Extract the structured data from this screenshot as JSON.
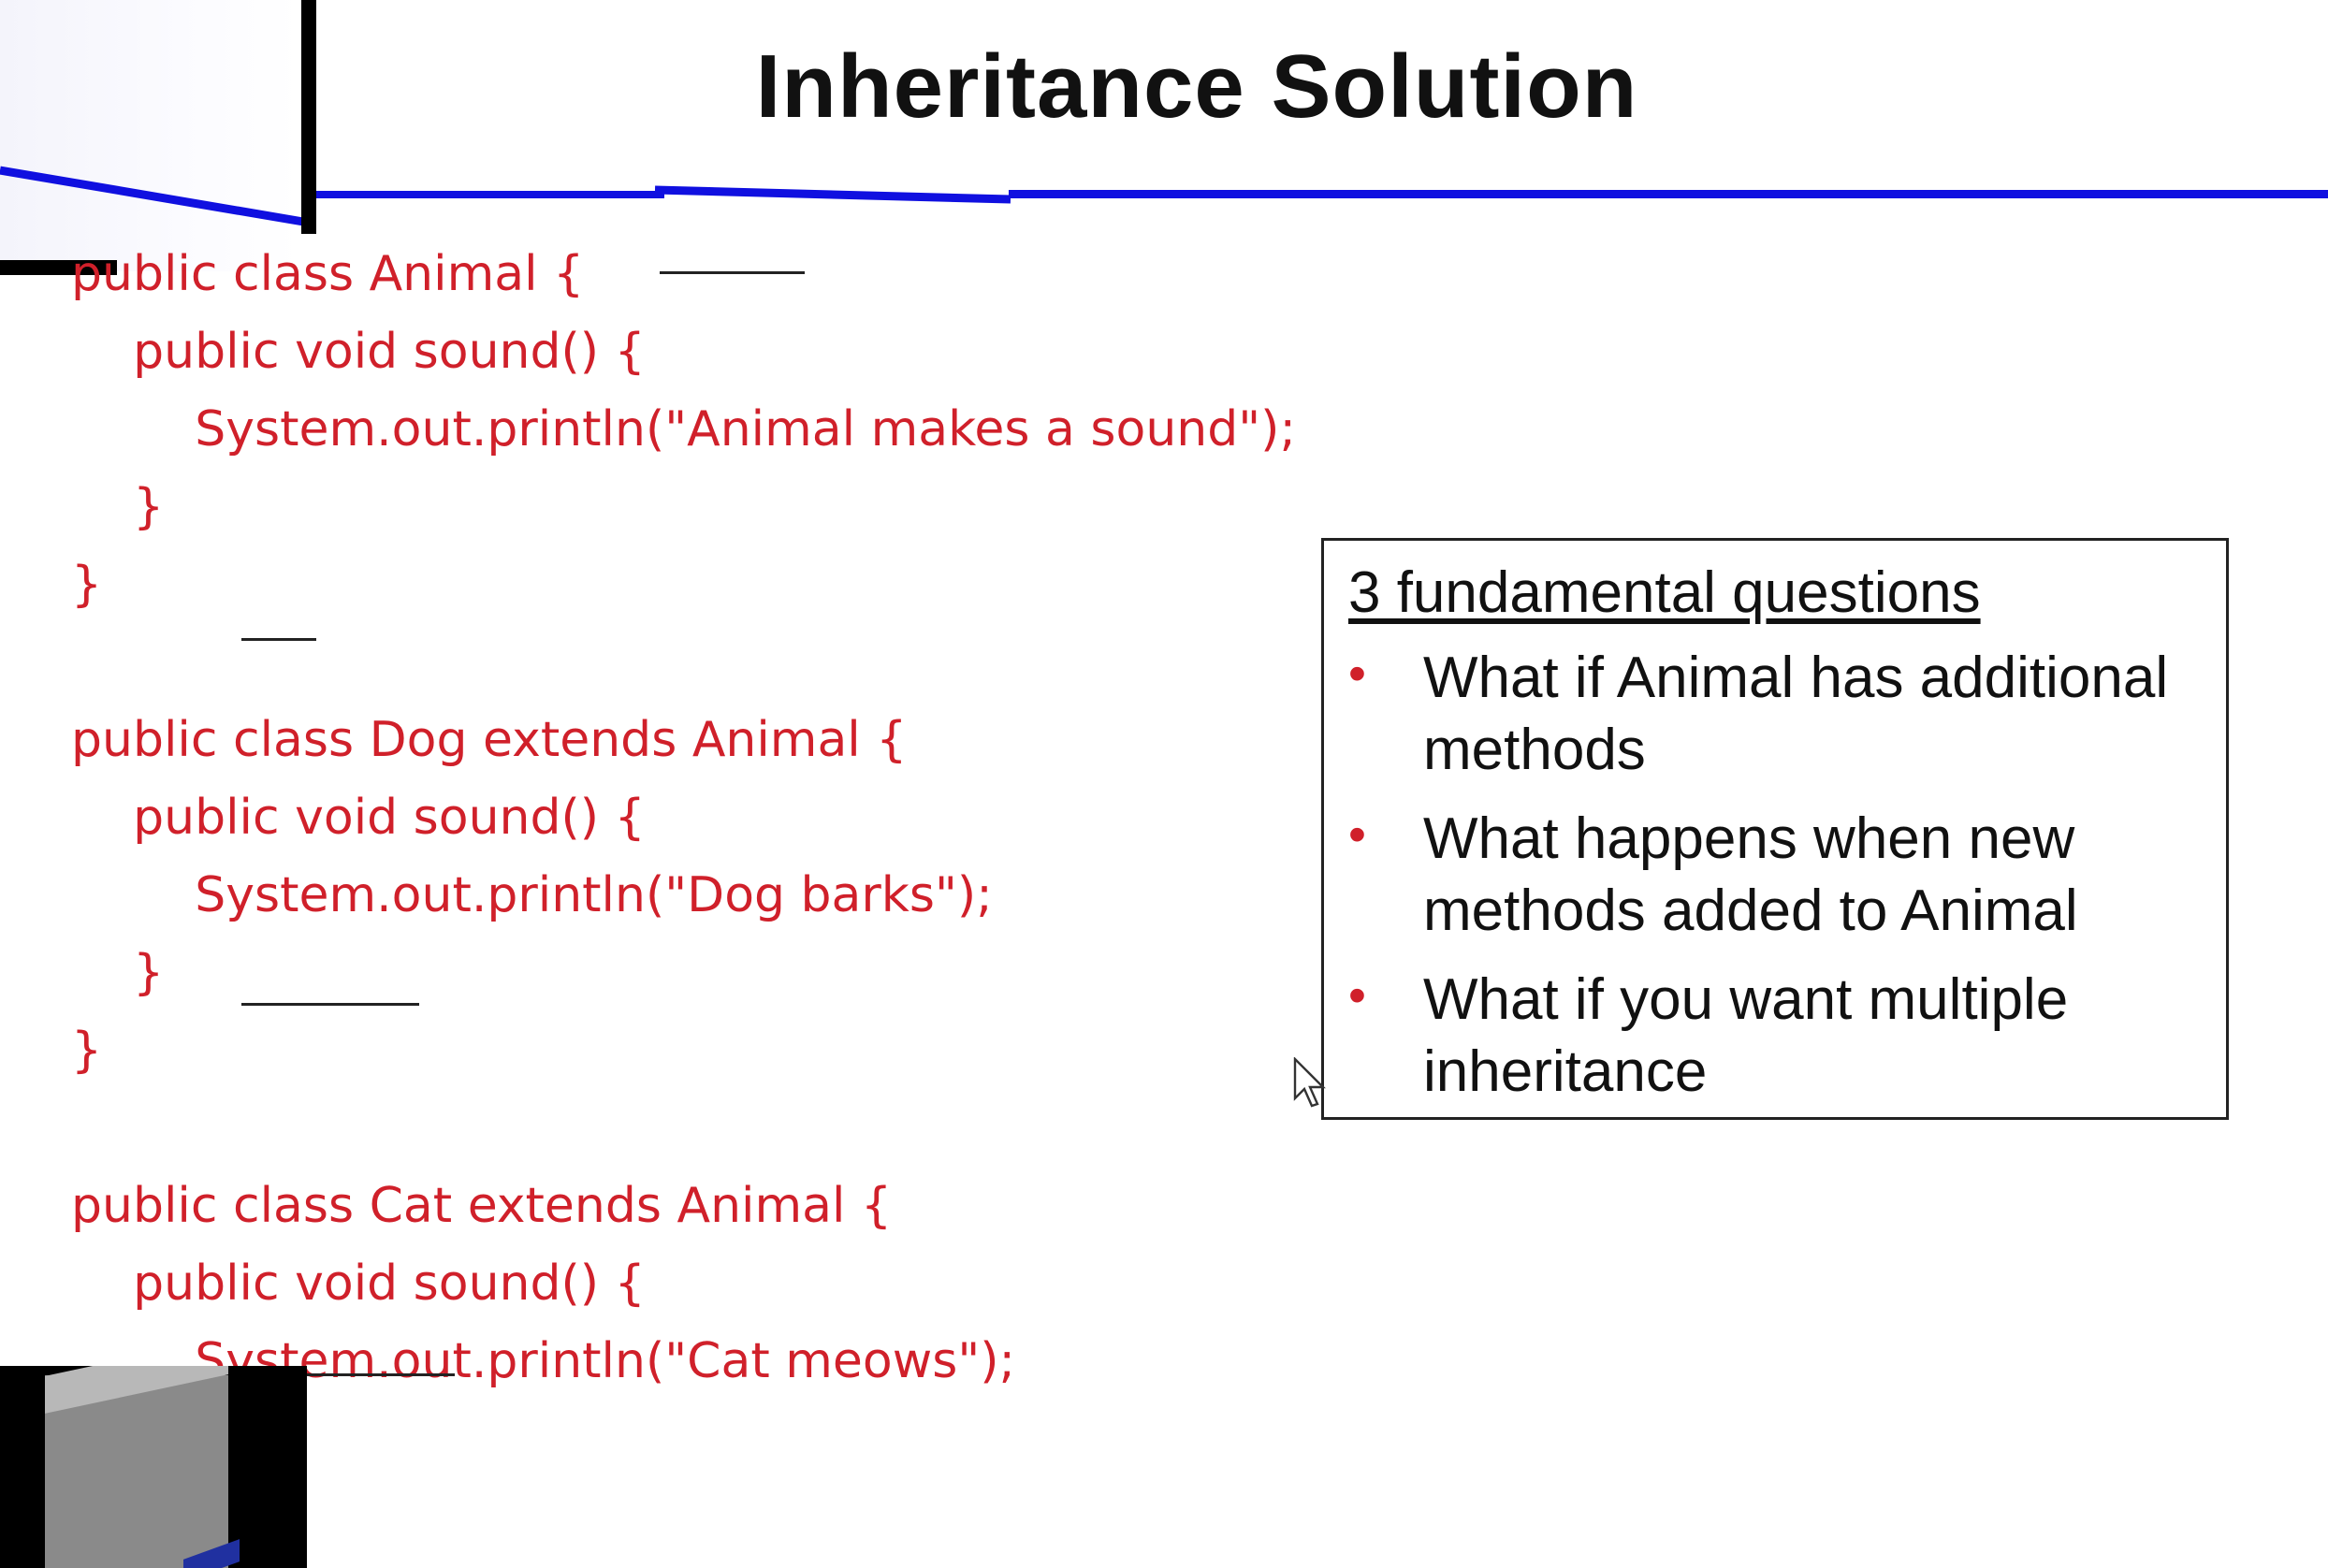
{
  "slide": {
    "title": "Inheritance Solution",
    "code_lines": [
      "public class Animal {",
      "    public void sound() {",
      "        System.out.println(\"Animal makes a sound\");",
      "    }",
      "}",
      "",
      "public class Dog extends Animal {",
      "    public void sound() {",
      "        System.out.println(\"Dog barks\");",
      "    }",
      "}",
      "",
      "public class Cat extends Animal {",
      "    public void sound() {",
      "        System.out.println(\"Cat meows\");",
      "    }",
      "}"
    ],
    "questions": {
      "heading": "3 fundamental questions",
      "items": [
        "What if Animal has additional methods",
        "What happens when new methods added to Animal",
        "What if you want multiple inheritance"
      ]
    }
  },
  "colors": {
    "code_text": "#d0202a",
    "title_rule": "#1010e0",
    "bullet": "#d0202a"
  },
  "icons": [
    "mouse-cursor-icon"
  ]
}
